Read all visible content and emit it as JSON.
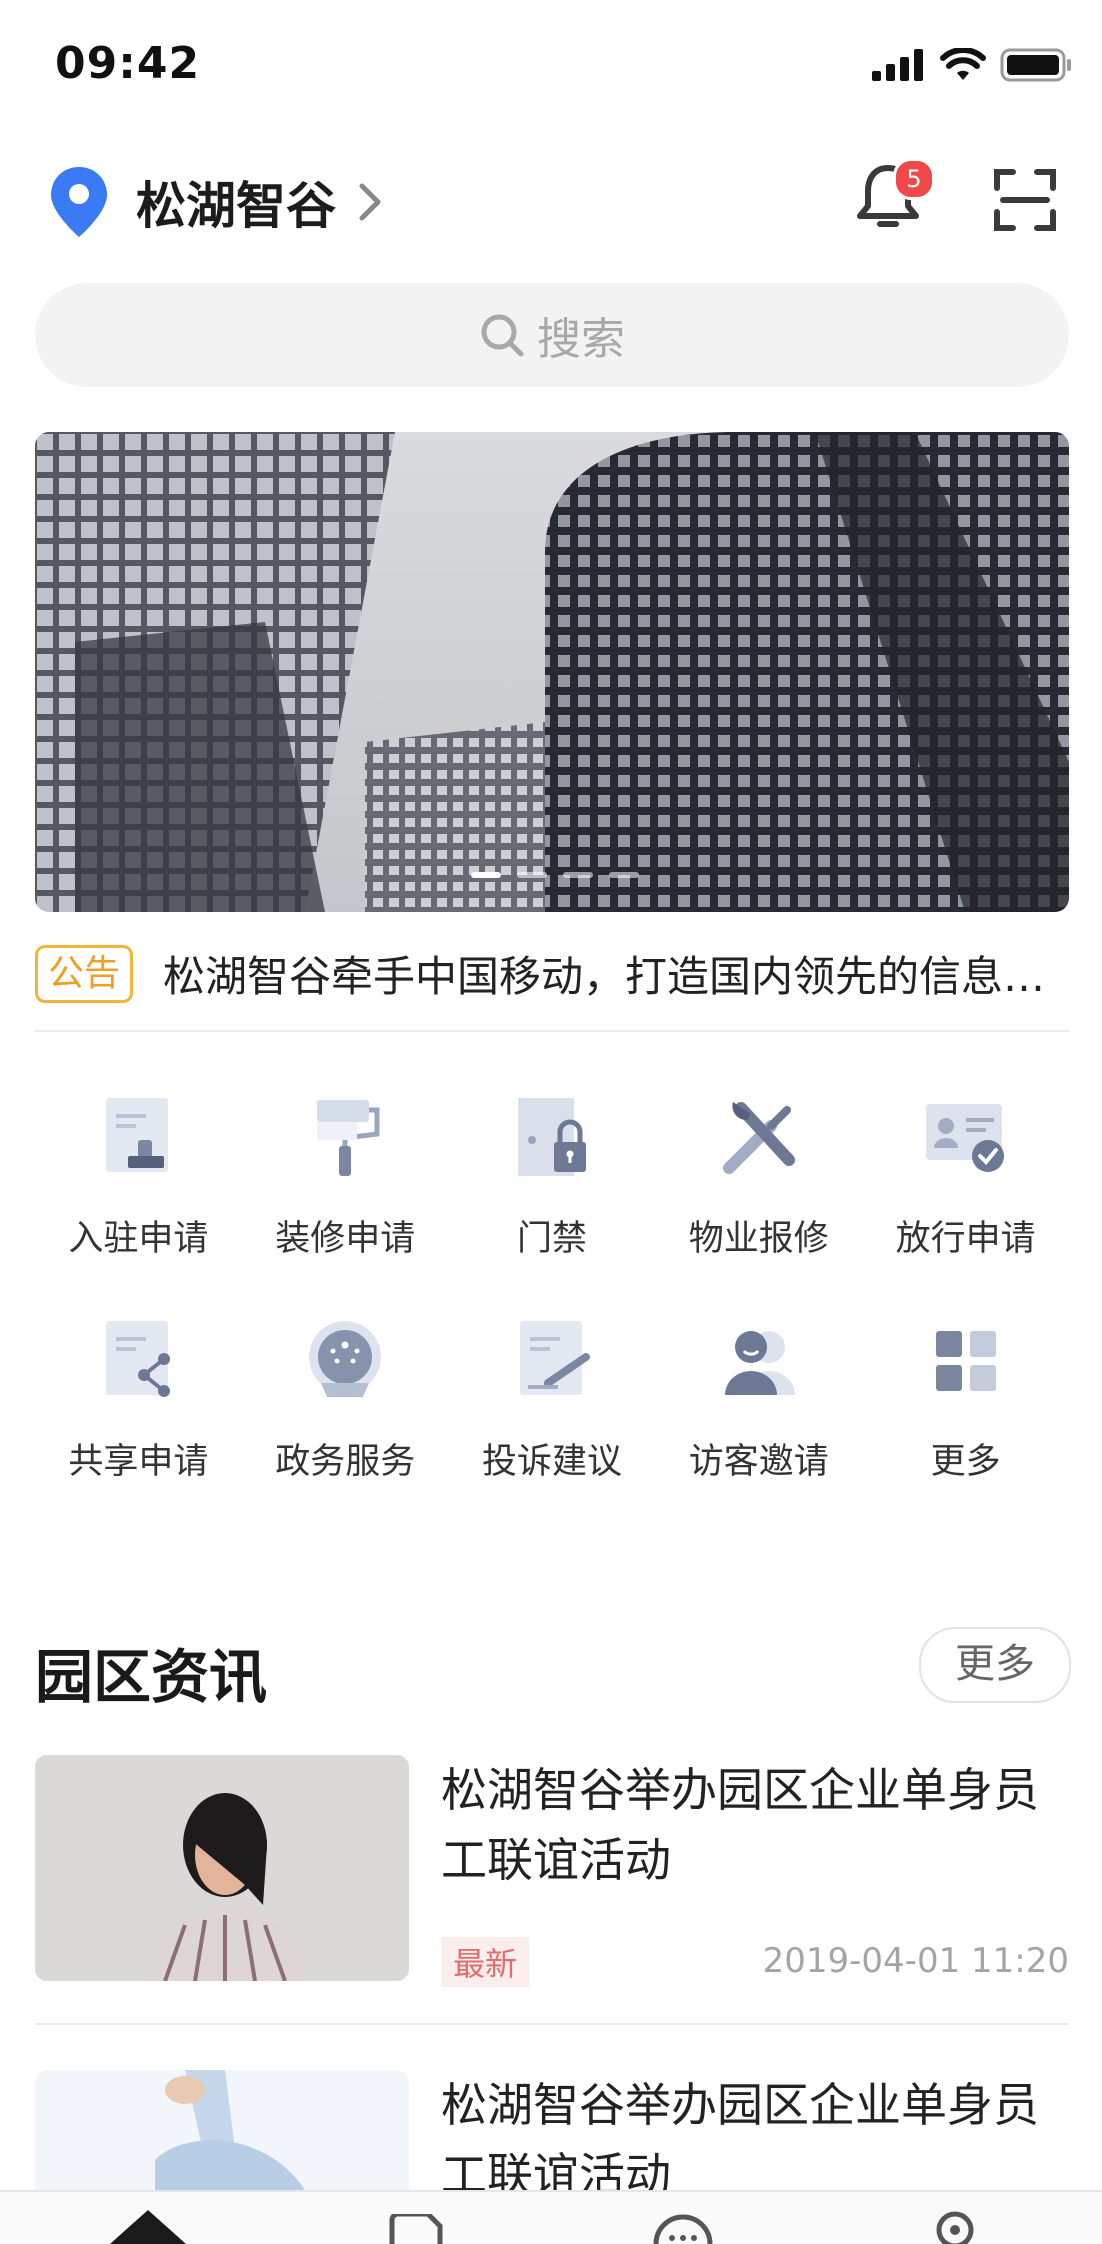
{
  "status_bar": {
    "time": "09:42"
  },
  "header": {
    "location": "松湖智谷",
    "notification_count": "5"
  },
  "search": {
    "placeholder": "搜索"
  },
  "notice": {
    "tag": "公告",
    "text": "松湖智谷牵手中国移动，打造国内领先的信息…"
  },
  "services": [
    {
      "label": "入驻申请",
      "icon": "check-in-icon"
    },
    {
      "label": "装修申请",
      "icon": "paint-roller-icon"
    },
    {
      "label": "门禁",
      "icon": "door-lock-icon"
    },
    {
      "label": "物业报修",
      "icon": "tools-icon"
    },
    {
      "label": "放行申请",
      "icon": "id-card-check-icon"
    },
    {
      "label": "共享申请",
      "icon": "share-doc-icon"
    },
    {
      "label": "政务服务",
      "icon": "government-emblem-icon"
    },
    {
      "label": "投诉建议",
      "icon": "edit-doc-icon"
    },
    {
      "label": "访客邀请",
      "icon": "visitor-icon"
    },
    {
      "label": "更多",
      "icon": "grid-icon"
    }
  ],
  "news": {
    "section_title": "园区资讯",
    "more_label": "更多",
    "items": [
      {
        "title": "松湖智谷举办园区企业单身员工联谊活动",
        "tag": "最新",
        "date": "2019-04-01  11:20"
      },
      {
        "title": "松湖智谷举办园区企业单身员工联谊活动"
      }
    ]
  },
  "colors": {
    "accent": "#3a7bf5",
    "notice": "#f2b53a",
    "badge": "#f04848",
    "icon": "#8f9cb8"
  }
}
